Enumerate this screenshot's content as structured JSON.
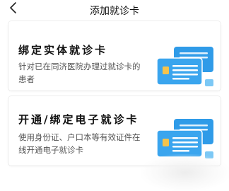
{
  "header": {
    "title": "添加就诊卡",
    "back_icon": "chevron-left-icon"
  },
  "options": [
    {
      "title": "绑定实体就诊卡",
      "description": "针对已在同济医院办理过就诊卡的患者",
      "icon": "id-card-icon"
    },
    {
      "title": "开通/绑定电子就诊卡",
      "description": "使用身份证、户口本等有效证件在线开通电子就诊卡",
      "icon": "id-card-icon"
    }
  ],
  "colors": {
    "card_primary": "#2f9be8",
    "card_secondary": "#7cc8f5",
    "chip": "#f5c34b"
  }
}
